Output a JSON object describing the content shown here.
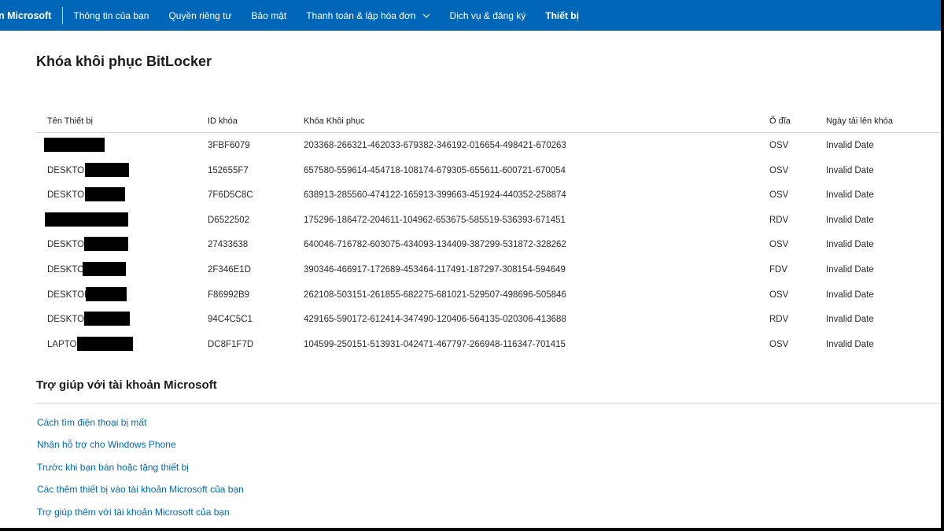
{
  "nav": {
    "brand": "n Microsoft",
    "items": [
      {
        "label": "Thông tin của bạn"
      },
      {
        "label": "Quyền riêng tư"
      },
      {
        "label": "Bảo mật"
      },
      {
        "label": "Thanh toán & lập hóa đơn"
      },
      {
        "label": "Dịch vụ & đăng ký"
      },
      {
        "label": "Thiết bị"
      }
    ],
    "active_item": "Thiết bị",
    "chevron_icon": "chevron-down-icon"
  },
  "page": {
    "title": "Khóa khôi phục BitLocker"
  },
  "table": {
    "headers": {
      "device": "Tên Thiết bị",
      "key_id": "ID khóa",
      "recovery_key": "Khóa Khôi phục",
      "drive": "Ổ đĩa",
      "upload_date": "Ngày tải lên khóa"
    },
    "rows": [
      {
        "name": "",
        "key_id": "3FBF6079",
        "recovery_key": "203368-266321-462033-679382-346192-016654-498421-670263",
        "drive": "OSV",
        "date": "Invalid Date"
      },
      {
        "name": "DESKTOP",
        "key_id": "152655F7",
        "recovery_key": "657580-559614-454718-108174-679305-655611-600721-670054",
        "drive": "OSV",
        "date": "Invalid Date"
      },
      {
        "name": "DESKTOP",
        "key_id": "7F6D5C8C",
        "recovery_key": "638913-285560-474122-165913-399663-451924-440352-258874",
        "drive": "OSV",
        "date": "Invalid Date"
      },
      {
        "name": "",
        "key_id": "D6522502",
        "recovery_key": "175296-186472-204611-104962-653675-585519-536393-671451",
        "drive": "RDV",
        "date": "Invalid Date"
      },
      {
        "name": "DESKTOP",
        "key_id": "27433638",
        "recovery_key": "640046-716782-603075-434093-134409-387299-531872-328262",
        "drive": "OSV",
        "date": "Invalid Date"
      },
      {
        "name": "DESKTOP",
        "key_id": "2F346E1D",
        "recovery_key": "390346-466917-172689-453464-117491-187297-308154-594649",
        "drive": "FDV",
        "date": "Invalid Date"
      },
      {
        "name": "DESKTOP",
        "key_id": "F86992B9",
        "recovery_key": "262108-503151-261855-682275-681021-529507-498696-505846",
        "drive": "OSV",
        "date": "Invalid Date"
      },
      {
        "name": "DESKTOP",
        "key_id": "94C4C5C1",
        "recovery_key": "429165-590172-612414-347490-120406-564135-020306-413688",
        "drive": "RDV",
        "date": "Invalid Date"
      },
      {
        "name": "LAPTOP",
        "key_id": "DC8F1F7D",
        "recovery_key": "104599-250151-513931-042471-467797-266948-116347-701415",
        "drive": "OSV",
        "date": "Invalid Date"
      }
    ]
  },
  "help": {
    "title": "Trợ giúp với tài khoản Microsoft",
    "links": [
      "Cách tìm điện thoại bị mất",
      "Nhận hỗ trợ cho Windows Phone",
      "Trước khi bạn bán hoặc tặng thiết bị",
      "Các thêm thiết bị vào tài khoản Microsoft của bạn",
      "Trợ giúp thêm với tài khoản Microsoft của bạn"
    ]
  },
  "colors": {
    "nav_background": "#0067b8",
    "link": "#0067b8",
    "redaction": "#000000"
  }
}
